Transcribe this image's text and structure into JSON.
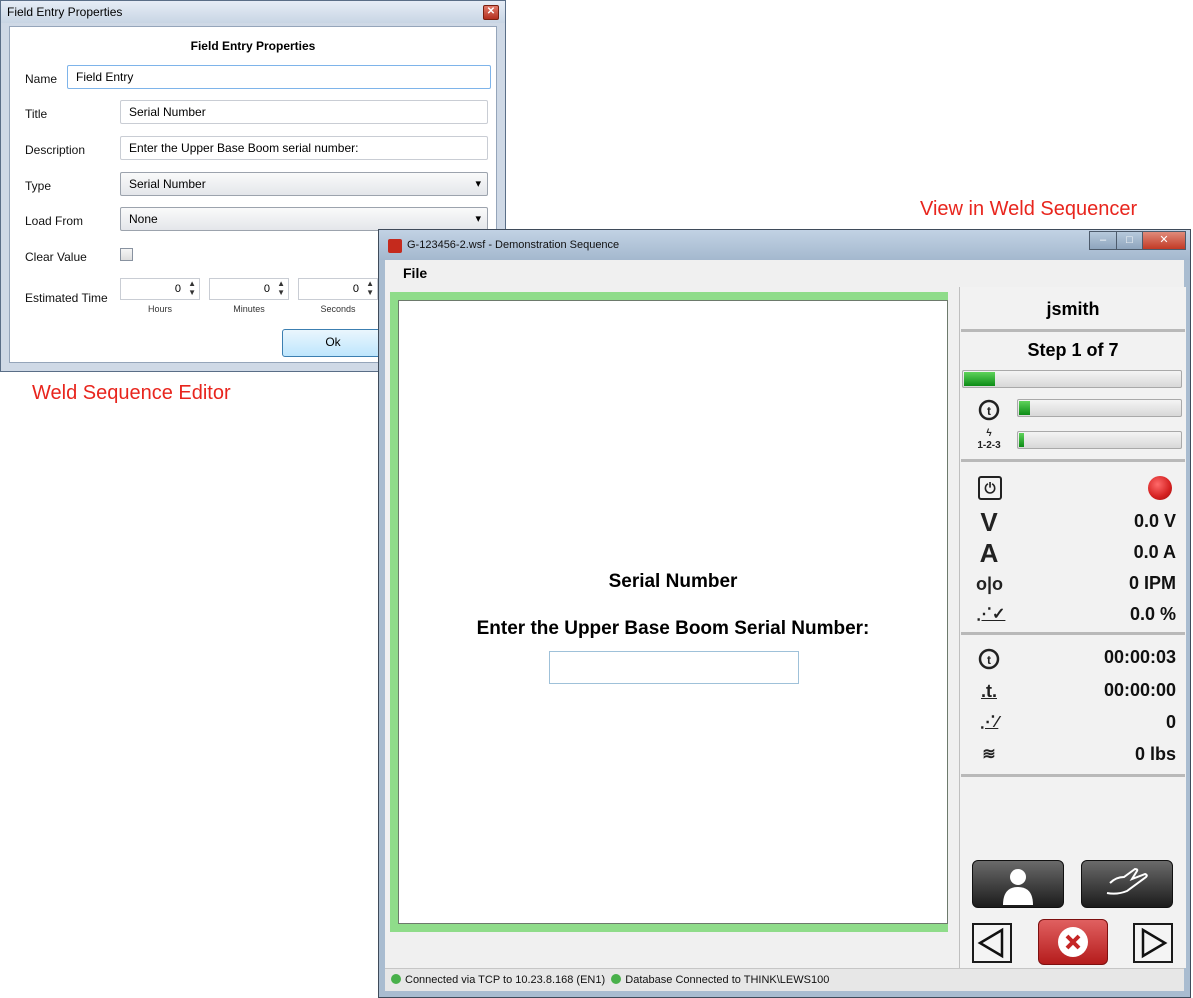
{
  "editor_dialog": {
    "window_title": "Field Entry Properties",
    "close_glyph": "✕",
    "header": "Field Entry Properties",
    "name_label": "Name",
    "name_value": "Field Entry",
    "title_label": "Title",
    "title_value": "Serial Number",
    "description_label": "Description",
    "description_value": "Enter the Upper Base Boom serial number:",
    "type_label": "Type",
    "type_value": "Serial Number",
    "load_from_label": "Load From",
    "load_from_value": "None",
    "clear_value_label": "Clear Value",
    "estimated_time_label": "Estimated Time",
    "hours_value": "0",
    "minutes_value": "0",
    "seconds_value": "0",
    "hours_caption": "Hours",
    "minutes_caption": "Minutes",
    "seconds_caption": "Seconds",
    "ok_label": "Ok"
  },
  "annotations": {
    "editor_caption": "Weld Sequence Editor",
    "sequencer_caption": "View in Weld Sequencer"
  },
  "sequencer": {
    "window_title": "G-123456-2.wsf - Demonstration Sequence",
    "menu_file": "File",
    "field_title": "Serial Number",
    "field_description": "Enter the Upper Base Boom Serial Number:",
    "user": "jsmith",
    "step_text": "Step 1 of 7",
    "overall_progress": 0.14,
    "time_progress": 0.07,
    "sequence_progress": 0.03,
    "voltage": "0.0 V",
    "current": "0.0 A",
    "wire_feed": "0 IPM",
    "percent": "0.0 %",
    "elapsed_time": "00:00:03",
    "arc_time": "00:00:00",
    "weld_count": "0",
    "wire_weight": "0 lbs",
    "status_tcp": "Connected via TCP to 10.23.8.168 (EN1)",
    "status_db": "Database Connected to THINK\\LEWS100"
  },
  "colors": {
    "annotation": "#e8251d",
    "field_border": "#8fdc8a",
    "status_dot": "#48b04a",
    "record_indicator": "#d42020"
  }
}
